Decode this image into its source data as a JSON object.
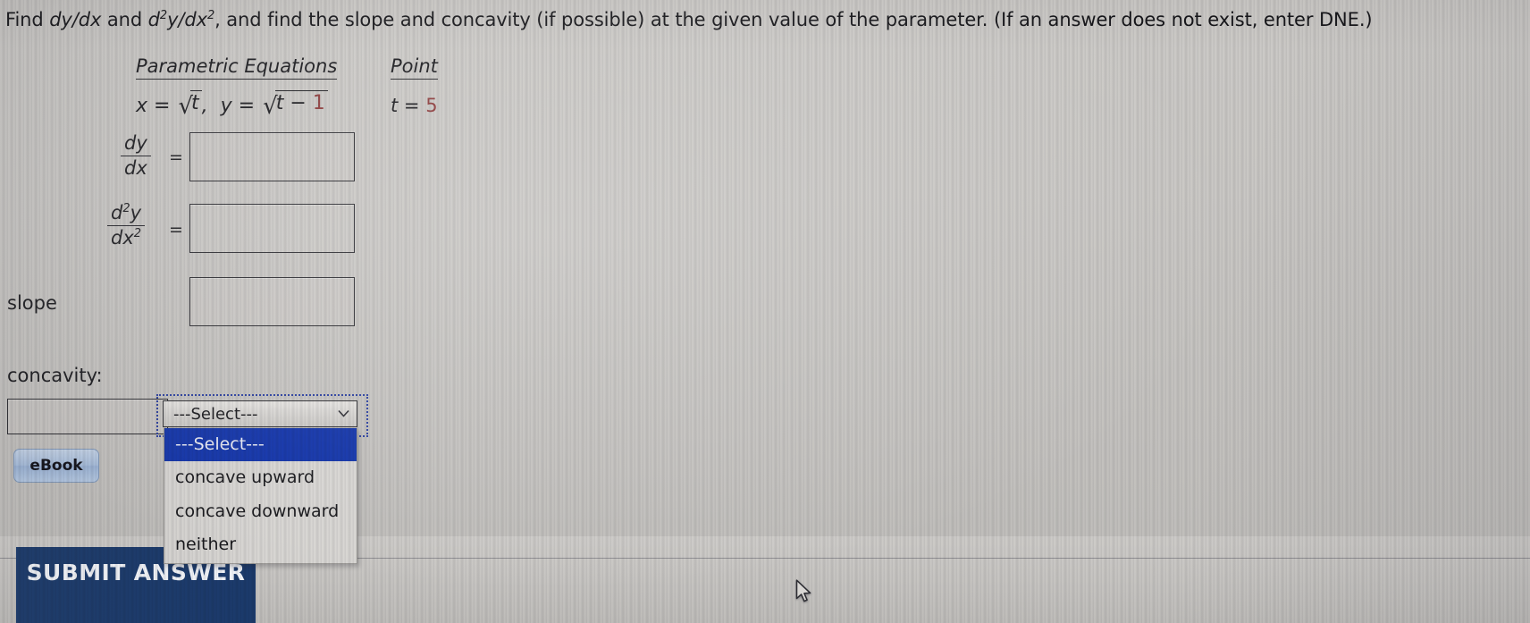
{
  "prompt": {
    "part1": "Find ",
    "dydx": "dy/dx",
    "part2": " and ",
    "d2ydx2_base": "d",
    "d2ydx2_sup1": "2",
    "d2ydx2_mid": "y/dx",
    "d2ydx2_sup2": "2",
    "part3": ", and find the slope and concavity (if possible) at the given value of the parameter. (If an answer does not exist, enter DNE.)"
  },
  "table": {
    "header_equations": "Parametric Equations",
    "header_point": "Point",
    "equation_x_lhs": "x = ",
    "equation_x_radicand": "t",
    "equation_comma": ", ",
    "equation_y_lhs": "y = ",
    "equation_y_radicand_t": "t ",
    "equation_y_radicand_minus": "− ",
    "equation_y_radicand_one": "1",
    "point_lhs": "t = ",
    "point_value": "5",
    "radical_glyph": "√"
  },
  "rows": {
    "dydx_num": "dy",
    "dydx_den": "dx",
    "dydx_equals": "=",
    "d2ydx2_num_d": "d",
    "d2ydx2_num_sup": "2",
    "d2ydx2_num_y": "y",
    "d2ydx2_den_dx": "dx",
    "d2ydx2_den_sup": "2",
    "d2ydx2_equals": "=",
    "slope_label": "slope",
    "concavity_label": "concavity:"
  },
  "inputs": {
    "dydx_value": "",
    "dydx_placeholder": "",
    "d2ydx2_value": "",
    "d2ydx2_placeholder": "",
    "slope_value": "",
    "slope_placeholder": "",
    "concavity_text_value": "",
    "concavity_text_placeholder": ""
  },
  "select": {
    "selected_label": "---Select---",
    "arrow_glyph": "⌄",
    "options": [
      {
        "label": "---Select---",
        "selected": true
      },
      {
        "label": "concave upward",
        "selected": false
      },
      {
        "label": "concave downward",
        "selected": false
      },
      {
        "label": "neither",
        "selected": false
      }
    ]
  },
  "buttons": {
    "ebook_label": "eBook",
    "submit_label": "SUBMIT ANSWER"
  },
  "colors": {
    "accent_red": "#8d3b3b",
    "select_highlight": "#1032a8",
    "submit_bg": "#1b3a6b",
    "ebook_bg": "#a7bddb",
    "focus_ring": "#2a3fa0"
  }
}
